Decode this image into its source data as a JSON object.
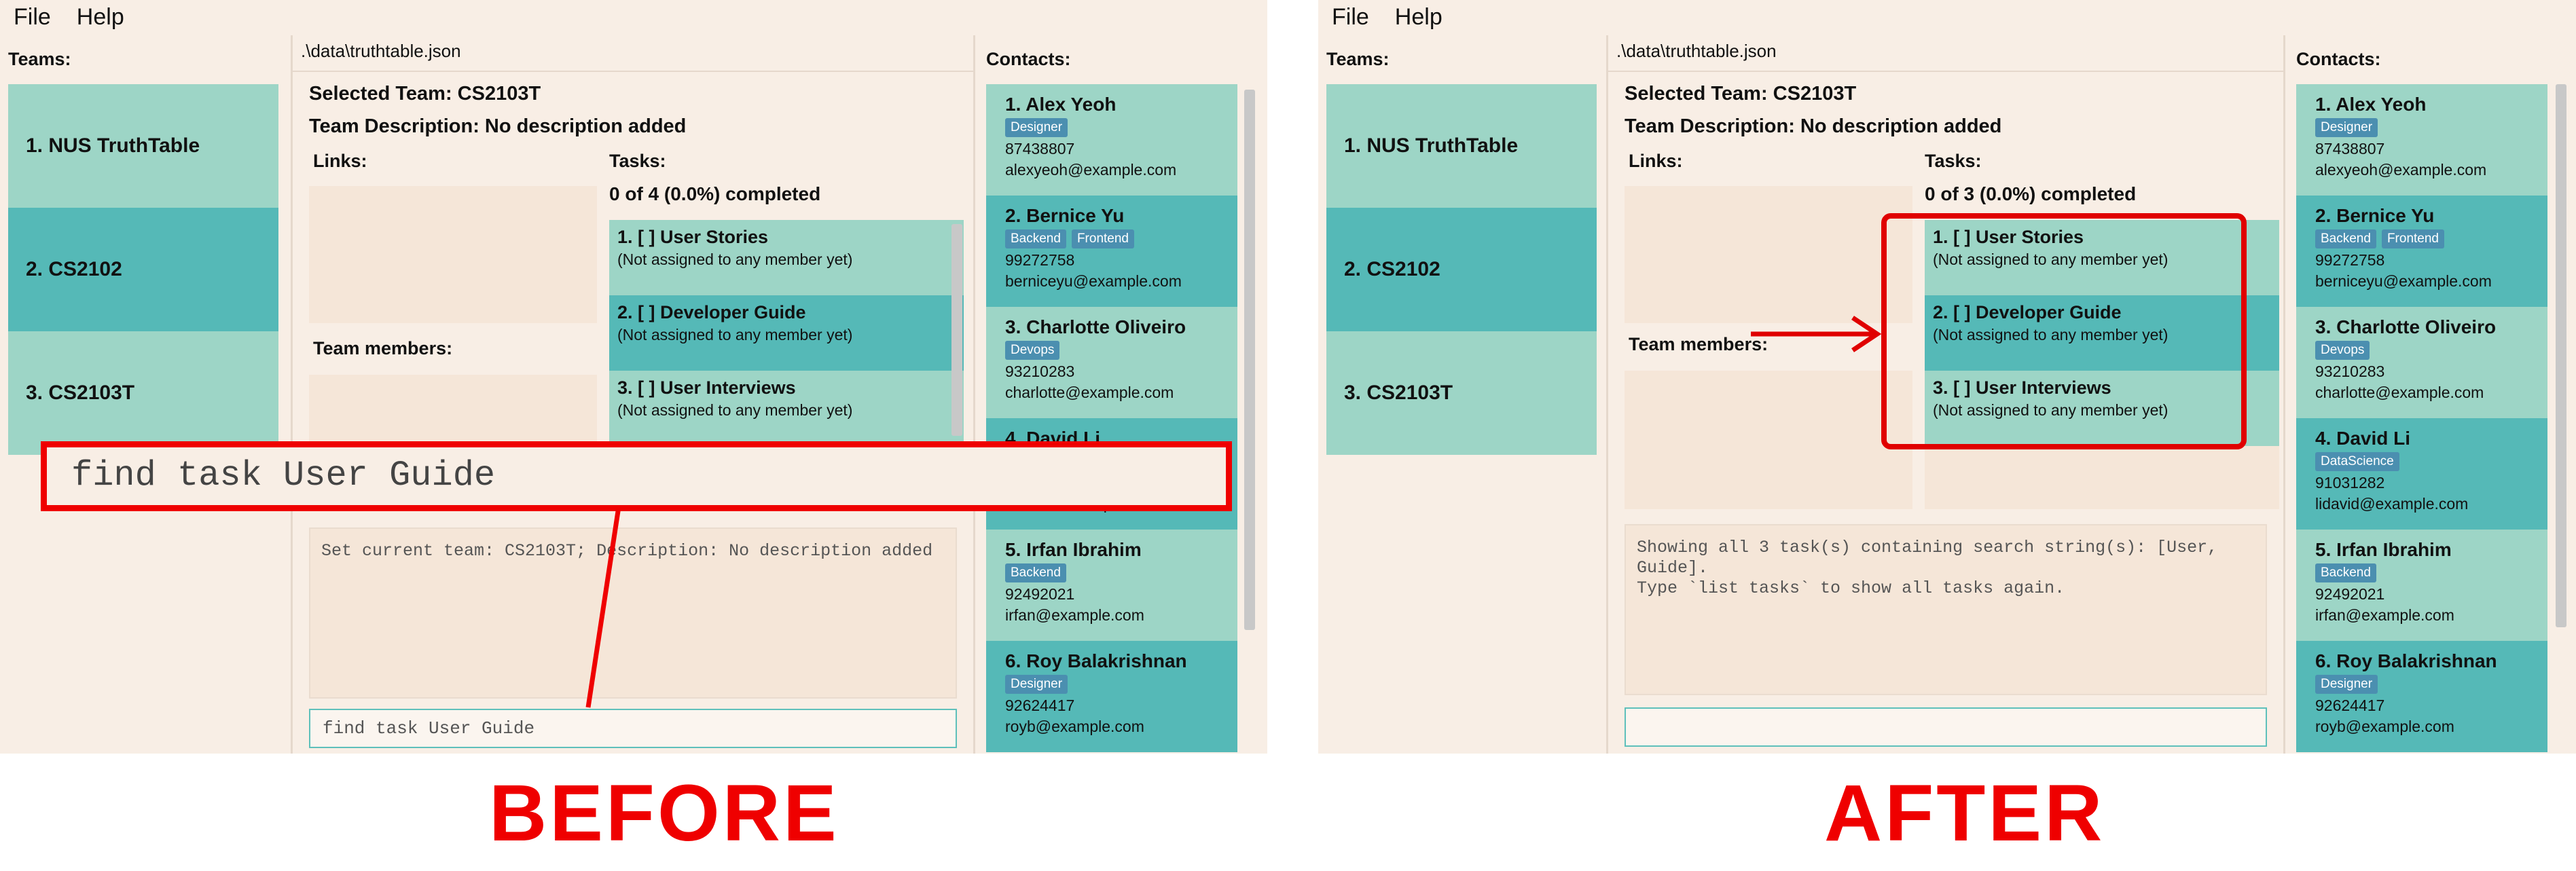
{
  "menu": {
    "file": "File",
    "help": "Help"
  },
  "teams_header": "Teams:",
  "teams": [
    "1. NUS TruthTable",
    "2. CS2102",
    "3. CS2103T"
  ],
  "path": ".\\data\\truthtable.json",
  "selected_team": "Selected Team: CS2103T",
  "team_description": "Team Description: No description added",
  "links_label": "Links:",
  "tasks_label": "Tasks:",
  "team_members_label": "Team members:",
  "contacts_header": "Contacts:",
  "contacts": [
    {
      "name": "1. Alex Yeoh",
      "tags": [
        "Designer"
      ],
      "phone": "87438807",
      "email": "alexyeoh@example.com"
    },
    {
      "name": "2. Bernice Yu",
      "tags": [
        "Backend",
        "Frontend"
      ],
      "phone": "99272758",
      "email": "berniceyu@example.com"
    },
    {
      "name": "3. Charlotte Oliveiro",
      "tags": [
        "Devops"
      ],
      "phone": "93210283",
      "email": "charlotte@example.com"
    },
    {
      "name": "4. David Li",
      "tags": [
        "DataScience"
      ],
      "phone": "91031282",
      "email": "lidavid@example.com"
    },
    {
      "name": "5. Irfan Ibrahim",
      "tags": [
        "Backend"
      ],
      "phone": "92492021",
      "email": "irfan@example.com"
    },
    {
      "name": "6. Roy Balakrishnan",
      "tags": [
        "Designer"
      ],
      "phone": "92624417",
      "email": "royb@example.com"
    }
  ],
  "before": {
    "tasks_summary": "0 of 4 (0.0%) completed",
    "tasks": [
      {
        "title": "1. [ ] User Stories",
        "sub": "(Not assigned to any member yet)"
      },
      {
        "title": "2. [ ] Developer Guide",
        "sub": "(Not assigned to any member yet)"
      },
      {
        "title": "3. [ ] User Interviews",
        "sub": "(Not assigned to any member yet)"
      }
    ],
    "result_text": "Set current team: CS2103T; Description: No description added",
    "command_text": "find task User Guide",
    "overlay_command": "find task User Guide",
    "label": "BEFORE"
  },
  "after": {
    "tasks_summary": "0 of 3 (0.0%) completed",
    "tasks": [
      {
        "title": "1. [ ] User Stories",
        "sub": "(Not assigned to any member yet)"
      },
      {
        "title": "2. [ ] Developer Guide",
        "sub": "(Not assigned to any member yet)"
      },
      {
        "title": "3. [ ] User Interviews",
        "sub": "(Not assigned to any member yet)"
      }
    ],
    "result_text": "Showing all 3 task(s) containing search string(s): [User,\nGuide].\nType `list tasks` to show all tasks again.",
    "command_text": "",
    "label": "AFTER"
  },
  "colors": {
    "teal_light": "#9dd5c6",
    "teal_dark": "#55b9b7",
    "accent_red": "#ef0000",
    "tag_blue": "#4b8fb0",
    "background": "#f8eee5"
  }
}
